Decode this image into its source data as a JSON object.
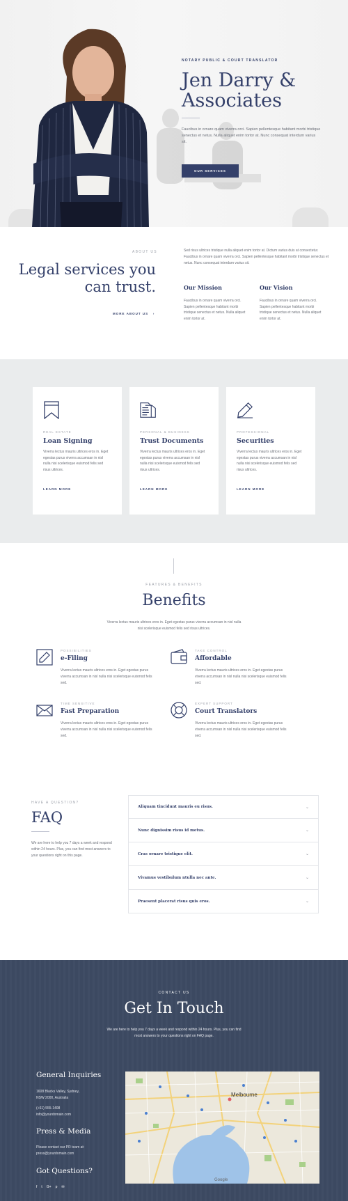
{
  "hero": {
    "eyebrow": "NOTARY PUBLIC & COURT TRANSLATOR",
    "title_line1": "Jen Darry &",
    "title_line2": "Associates",
    "text": "Faucibus in ornare quam viverra orci. Sapien pellentesque habitant morbi tristique senectus et netus. Nulla aliquet enim tortor at. Nunc consequat interdum varius sit.",
    "button": "OUR SERVICES"
  },
  "about": {
    "label": "ABOUT US",
    "heading_line1": "Legal services you",
    "heading_line2": "can trust.",
    "more": "MORE ABOUT US",
    "intro": "Sed risus ultrices tristique nulla aliquet enim tortor at. Dictum varius duis at consectetur. Faucibus in ornare quam viverra orci. Sapien pellentesque habitant morbi tristique senectus et netus. Nunc consequat interdum varius sit.",
    "mission_title": "Our Mission",
    "mission_text": "Faucibus in ornare quam viverra orci. Sapien pellentesque habitant morbi tristique senectus et netus. Nulla aliquet enim tortor at.",
    "vision_title": "Our Vision",
    "vision_text": "Faucibus in ornare quam viverra orci. Sapien pellentesque habitant morbi tristique senectus et netus. Nulla aliquet enim tortor at."
  },
  "services": [
    {
      "icon": "bookmark-icon",
      "category": "REAL ESTATE",
      "title": "Loan Signing",
      "text": "Viverra lectus mauris ultrices eros in. Eget egestas purus viverra accumsan in nisl nulla nisi scelerisque euismod felis sed risus ultrices.",
      "link": "LEARN MORE"
    },
    {
      "icon": "document-icon",
      "category": "PERSONAL & BUSINESS",
      "title": "Trust Documents",
      "text": "Viverra lectus mauris ultrices eros in. Eget egestas purus viverra accumsan in nisl nulla nisi scelerisque euismod felis sed risus ultrices.",
      "link": "LEARN MORE"
    },
    {
      "icon": "pencil-icon",
      "category": "PROFESSIONAL",
      "title": "Securities",
      "text": "Viverra lectus mauris ultrices eros in. Eget egestas purus viverra accumsan in nisl nulla nisi scelerisque euismod felis sed risus ultrices.",
      "link": "LEARN MORE"
    }
  ],
  "benefits": {
    "label": "FEATURES & BENEFITS",
    "title": "Benefits",
    "subtitle": "Viverra lectus mauris ultrices eros in. Eget egestas purus viverra accumsan in nisl nulla nisi scelerisque euismod felis sed risus ultrices.",
    "items": [
      {
        "icon": "pencil-box-icon",
        "category": "POSSIBILITIES",
        "title": "e-Filing",
        "text": "Viverra lectus mauris ultrices eros in. Eget egestas purus viverra accumsan in nisl nulla nisi scelerisque euismod felis sed."
      },
      {
        "icon": "wallet-icon",
        "category": "TAKE CONTROL",
        "title": "Affordable",
        "text": "Viverra lectus mauris ultrices eros in. Eget egestas purus viverra accumsan in nisl nulla nisi scelerisque euismod felis sed."
      },
      {
        "icon": "envelope-icon",
        "category": "TIME SENSITIVE",
        "title": "Fast Preparation",
        "text": "Viverra lectus mauris ultrices eros in. Eget egestas purus viverra accumsan in nisl nulla nisi scelerisque euismod felis sed."
      },
      {
        "icon": "lifebuoy-icon",
        "category": "EXPERT SUPPORT",
        "title": "Court Translators",
        "text": "Viverra lectus mauris ultrices eros in. Eget egestas purus viverra accumsan in nisl nulla nisi scelerisque euismod felis sed."
      }
    ]
  },
  "faq": {
    "label": "HAVE A QUESTION?",
    "title": "FAQ",
    "text": "We are here to help you 7 days a week and respond within 24 hours. Plus, you can find most answers to your questions right on this page.",
    "questions": [
      "Aliquam tincidunt mauris eu risus.",
      "Nunc dignissim risus id metus.",
      "Cras ornare tristique elit.",
      "Vivamus vestibulum ntulla nec ante.",
      "Praesent placerat risus quis eros."
    ]
  },
  "contact": {
    "label": "CONTACT US",
    "title": "Get In Touch",
    "subtitle": "We are here to help you 7 days a week and respond within 24 hours. Plus, you can find most answers to your questions right on FAQ page.",
    "general_title": "General Inquiries",
    "address1": "1608 Blacks Valley, Sydney,",
    "address2": "NSW 2000, Australia",
    "phone": "(+61) 555-1408",
    "email": "info@yourdomain.com",
    "press_title": "Press & Media",
    "press1": "Please contact our PR team at:",
    "press2": "press@yourdomain.com",
    "questions_title": "Got Questions?",
    "socials": [
      "facebook-icon",
      "twitter-icon",
      "google-plus-icon",
      "pinterest-icon",
      "mail-icon"
    ],
    "map_label": "Melbourne",
    "map_credit": "Google"
  }
}
